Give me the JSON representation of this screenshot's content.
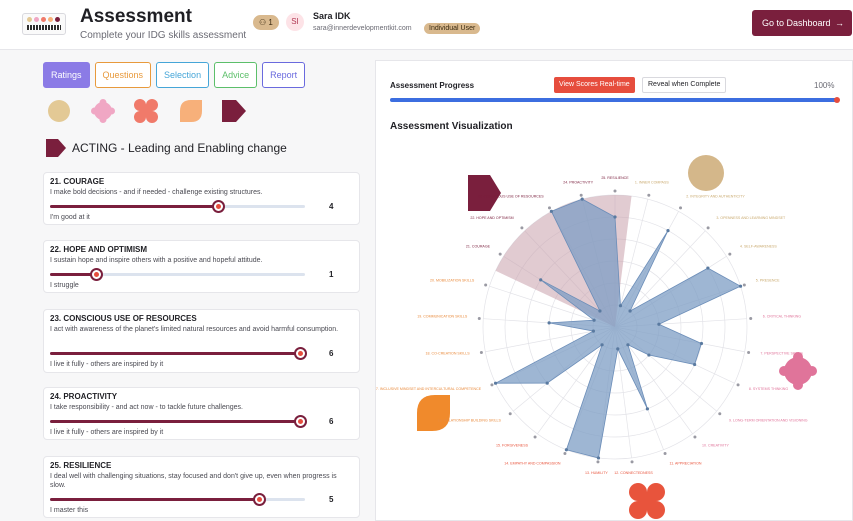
{
  "header": {
    "title": "Assessment",
    "subtitle": "Complete your IDG skills assessment",
    "user_count": "1",
    "avatar_initials": "SI",
    "user_name": "Sara IDK",
    "user_email": "sara@innerdevelopmentkit.com",
    "user_type": "Individual User",
    "dashboard_label": "Go to Dashboard",
    "dashboard_arrow": "→"
  },
  "tabs": [
    {
      "label": "Ratings",
      "color": "#8b7be6",
      "active": true
    },
    {
      "label": "Questions",
      "color": "#e89a3c"
    },
    {
      "label": "Selection",
      "color": "#46a6d8"
    },
    {
      "label": "Advice",
      "color": "#5cbf6a"
    },
    {
      "label": "Report",
      "color": "#6a6ade"
    }
  ],
  "dimension_shapes": [
    {
      "name": "being-circle",
      "color": "#e3c995"
    },
    {
      "name": "thinking-flower",
      "color": "#f0a7c4"
    },
    {
      "name": "relating-cross",
      "color": "#f07a6a"
    },
    {
      "name": "collaborating-leaf",
      "color": "#f7b07a"
    },
    {
      "name": "acting-pentagon",
      "color": "#7a1f3d"
    }
  ],
  "section_title": "ACTING - Leading and Enabling change",
  "items": [
    {
      "title": "21. COURAGE",
      "desc": "I make bold decisions - and if needed - challenge existing structures.",
      "value": "4",
      "fraction": 0.66,
      "level": "I'm good at it"
    },
    {
      "title": "22. HOPE AND OPTIMISM",
      "desc": "I sustain hope and inspire others with a positive and hopeful attitude.",
      "value": "1",
      "fraction": 0.18,
      "level": "I struggle"
    },
    {
      "title": "23. CONSCIOUS USE OF RESOURCES",
      "desc": "I act with awareness of the planet's limited natural resources and avoid harmful consumption.",
      "value": "6",
      "fraction": 0.98,
      "level": "I live it fully - others are inspired by it"
    },
    {
      "title": "24. PROACTIVITY",
      "desc": "I take responsibility - and act now - to tackle future challenges.",
      "value": "6",
      "fraction": 0.98,
      "level": "I live it fully - others are inspired by it"
    },
    {
      "title": "25. RESILIENCE",
      "desc": "I deal well with challenging situations, stay focused and don't give up, even when progress is slow.",
      "value": "5",
      "fraction": 0.82,
      "level": "I master this"
    }
  ],
  "progress": {
    "label": "Assessment Progress",
    "view_label": "View Scores Real-time",
    "reveal_label": "Reveal when Complete",
    "percent": "100%",
    "fraction": 1.0
  },
  "viz_title": "Assessment Visualization",
  "chart_data": {
    "type": "radar",
    "max": 6,
    "categories": [
      "1. INNER COMPASS",
      "2. INTEGRITY AND AUTHENTICITY",
      "3. OPENNESS AND LEARNING MINDSET",
      "4. SELF-AWARENESS",
      "5. PRESENCE",
      "6. CRITICAL THINKING",
      "7. PERSPECTIVE SKILLS",
      "8. SYSTEMS THINKING",
      "9. LONG-TERM ORIENTATION AND VISIONING",
      "10. CREATIVITY",
      "11. APPRECIATION",
      "12. CONNECTEDNESS",
      "13. HUMILITY",
      "14. EMPATHY AND COMPASSION",
      "15. FORGIVENESS",
      "16. RELATIONSHIP BUILDING SKILLS",
      "17. INCLUSIVE MINDSET AND INTERCULTURAL COMPETENCE",
      "18. CO-CREATION SKILLS",
      "19. COMMUNICATION SKILLS",
      "20. MOBILIZATION SKILLS",
      "21. COURAGE",
      "22. HOPE AND OPTIMISM",
      "23. CONSCIOUS USE OF RESOURCES",
      "24. PROACTIVITY",
      "25. RESILIENCE"
    ],
    "values": [
      1,
      5,
      1,
      5,
      6,
      2,
      4,
      4,
      2,
      1,
      4,
      1,
      6,
      6,
      1,
      4,
      6,
      1,
      3,
      1,
      4,
      1,
      6,
      6,
      5
    ],
    "category_colors": [
      "#c9a96e",
      "#c9a96e",
      "#c9a96e",
      "#c9a96e",
      "#c9a96e",
      "#e0749a",
      "#e0749a",
      "#e0749a",
      "#e0749a",
      "#e0749a",
      "#e8543c",
      "#e8543c",
      "#e8543c",
      "#e8543c",
      "#e8543c",
      "#e98a3c",
      "#e98a3c",
      "#e98a3c",
      "#e98a3c",
      "#e98a3c",
      "#7a1f3d",
      "#7a1f3d",
      "#7a1f3d",
      "#7a1f3d",
      "#7a1f3d"
    ],
    "series_color": "#7d9ec4",
    "highlight_color": "#c9a0ab",
    "grid": true
  }
}
